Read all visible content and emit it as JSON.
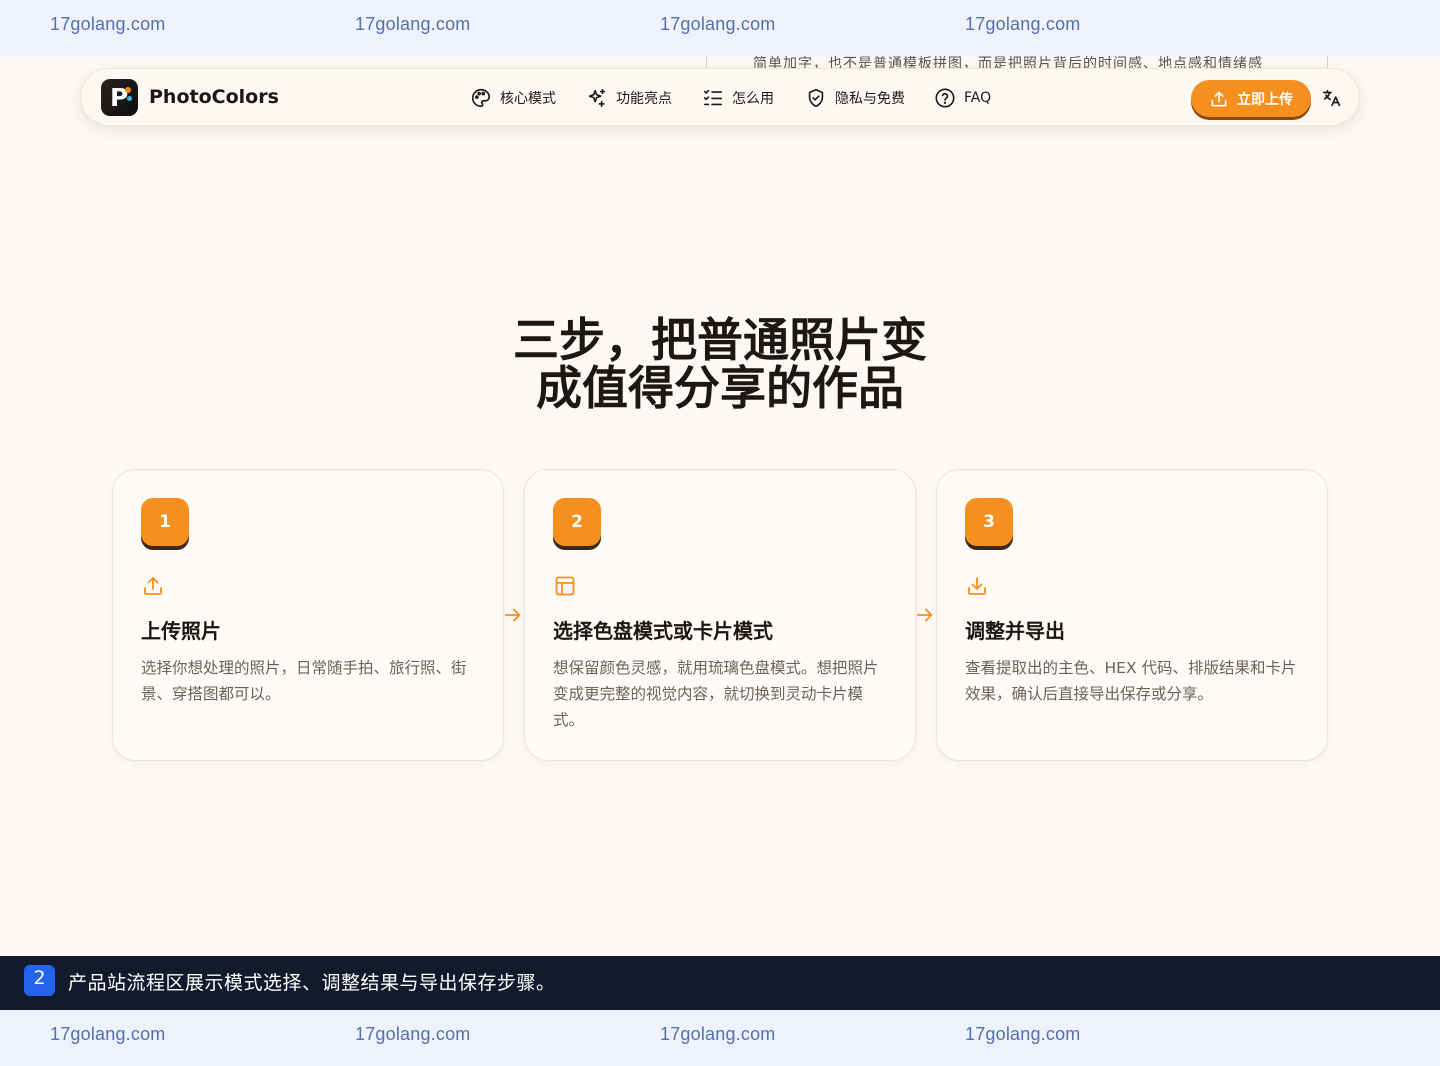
{
  "watermark": {
    "text": "17golang.com"
  },
  "peek": {
    "text": "简单加字，也不是普通模板拼图，而是把照片背后的时间感、地点感和情绪感"
  },
  "nav": {
    "brand": "PhotoColors",
    "items": [
      {
        "label": "核心模式",
        "icon": "palette-icon"
      },
      {
        "label": "功能亮点",
        "icon": "sparkles-icon"
      },
      {
        "label": "怎么用",
        "icon": "list-checks-icon"
      },
      {
        "label": "隐私与免费",
        "icon": "shield-check-icon"
      },
      {
        "label": "FAQ",
        "icon": "help-circle-icon"
      }
    ],
    "cta_label": "立即上传",
    "lang_icon": "translate-icon"
  },
  "section": {
    "title_line1": "三步，把普通照片变",
    "title_line2": "成值得分享的作品"
  },
  "steps": [
    {
      "num": "1",
      "icon": "upload-icon",
      "title": "上传照片",
      "desc": "选择你想处理的照片，日常随手拍、旅行照、街景、穿搭图都可以。"
    },
    {
      "num": "2",
      "icon": "layout-icon",
      "title": "选择色盘模式或卡片模式",
      "desc": "想保留颜色灵感，就用琉璃色盘模式。想把照片变成更完整的视觉内容，就切换到灵动卡片模式。"
    },
    {
      "num": "3",
      "icon": "download-icon",
      "title": "调整并导出",
      "desc": "查看提取出的主色、HEX 代码、排版结果和卡片效果，确认后直接导出保存或分享。"
    }
  ],
  "colors": {
    "accent": "#f5901e",
    "background": "#fdf8f3",
    "caption_bg": "#131a2c",
    "caption_badge": "#2463eb"
  },
  "caption": {
    "num": "2",
    "text": "产品站流程区展示模式选择、调整结果与导出保存步骤。"
  }
}
